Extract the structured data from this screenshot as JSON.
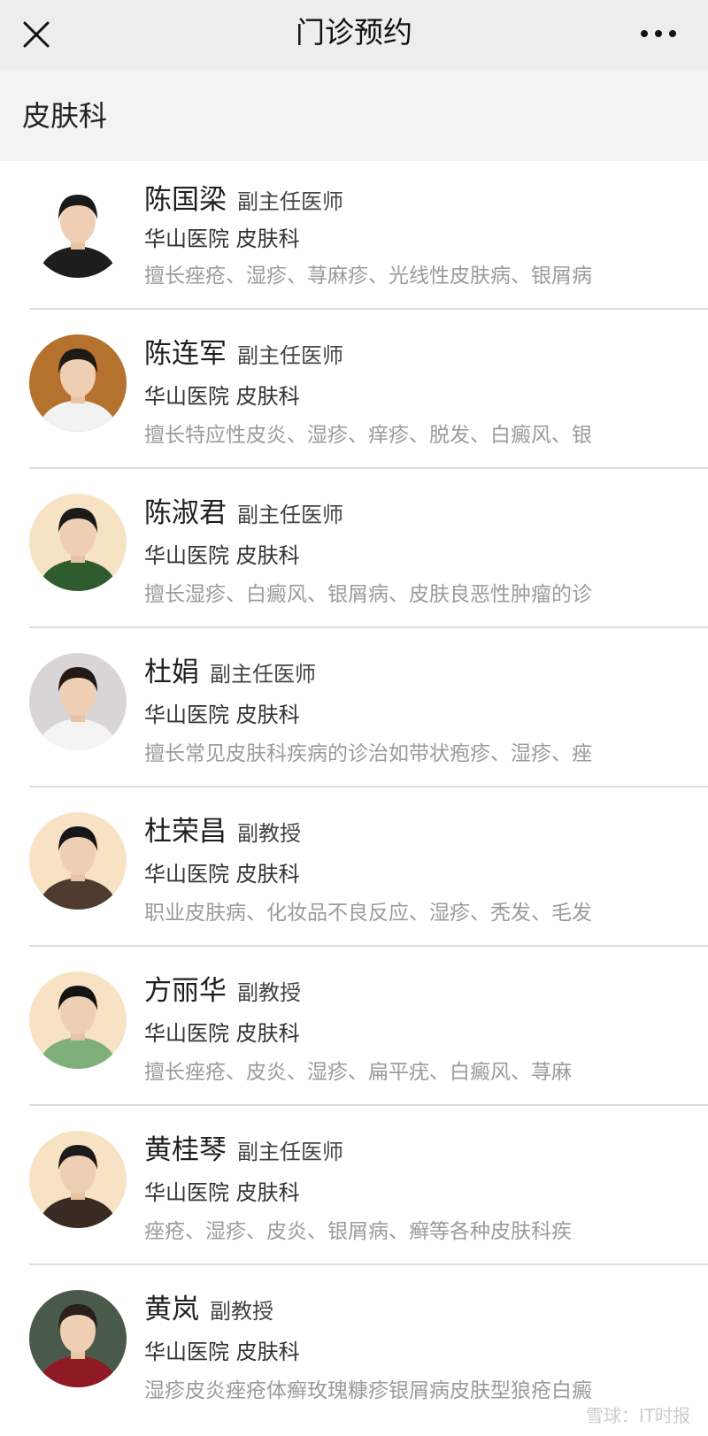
{
  "header": {
    "title": "门诊预约",
    "close_icon": "close-icon",
    "more_icon": "more-icon"
  },
  "section": {
    "title": "皮肤科"
  },
  "doctors": [
    {
      "name": "陈国梁",
      "title": "副主任医师",
      "hospital": "华山医院 皮肤科",
      "specialty": "擅长痤疮、湿疹、荨麻疹、光线性皮肤病、银屑病",
      "avatar_bg": "#ffffff",
      "clothing": "#1d1d1d",
      "hair": "#1a1a1a"
    },
    {
      "name": "陈连军",
      "title": "副主任医师",
      "hospital": "华山医院 皮肤科",
      "specialty": "擅长特应性皮炎、湿疹、痒疹、脱发、白癜风、银",
      "avatar_bg": "#b5722e",
      "clothing": "#f2f2f2",
      "hair": "#1f1a15"
    },
    {
      "name": "陈淑君",
      "title": "副主任医师",
      "hospital": "华山医院 皮肤科",
      "specialty": "擅长湿疹、白癜风、银屑病、皮肤良恶性肿瘤的诊",
      "avatar_bg": "#f6e3c4",
      "clothing": "#2f5c2f",
      "hair": "#1a1a1a"
    },
    {
      "name": "杜娟",
      "title": "副主任医师",
      "hospital": "华山医院 皮肤科",
      "specialty": "擅长常见皮肤科疾病的诊治如带状疱疹、湿疹、痤",
      "avatar_bg": "#d9d4d6",
      "clothing": "#f4f4f4",
      "hair": "#231a16"
    },
    {
      "name": "杜荣昌",
      "title": "副教授",
      "hospital": "华山医院 皮肤科",
      "specialty": "职业皮肤病、化妆品不良反应、湿疹、秃发、毛发",
      "avatar_bg": "#f7e2c3",
      "clothing": "#4e3a2e",
      "hair": "#15151a"
    },
    {
      "name": "方丽华",
      "title": "副教授",
      "hospital": "华山医院 皮肤科",
      "specialty": "擅长痤疮、皮炎、湿疹、扁平疣、白癜风、荨麻",
      "avatar_bg": "#f7e2c3",
      "clothing": "#7fb07a",
      "hair": "#141414"
    },
    {
      "name": "黄桂琴",
      "title": "副主任医师",
      "hospital": "华山医院 皮肤科",
      "specialty": "痤疮、湿疹、皮炎、银屑病、癣等各种皮肤科疾",
      "avatar_bg": "#f7e2c3",
      "clothing": "#3a2a24",
      "hair": "#1c1a1a"
    },
    {
      "name": "黄岚",
      "title": "副教授",
      "hospital": "华山医院 皮肤科",
      "specialty": "湿疹皮炎痤疮体癣玫瑰糠疹银屑病皮肤型狼疮白癜",
      "avatar_bg": "#4a5a4a",
      "clothing": "#8e1a24",
      "hair": "#2a1f1a"
    }
  ],
  "watermark": "雪球：IT时报"
}
